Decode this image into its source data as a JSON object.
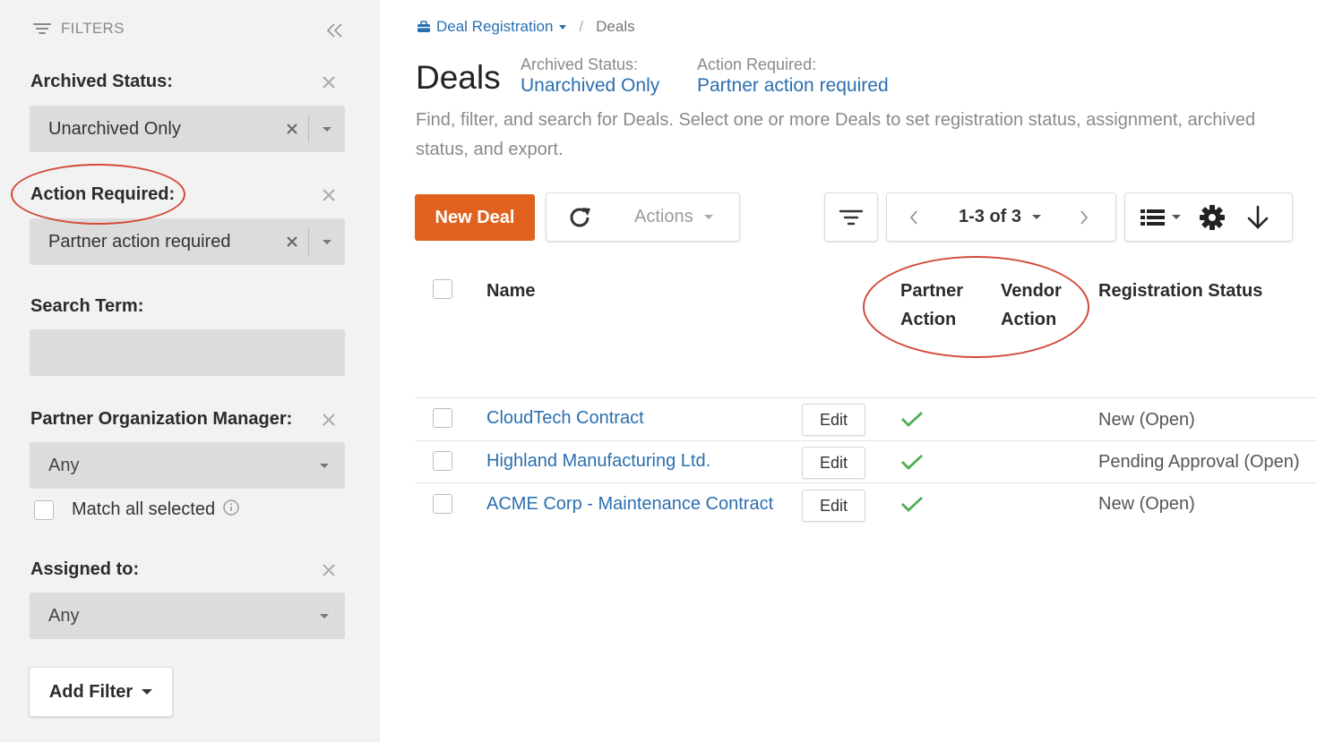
{
  "sidebar": {
    "header": "FILTERS",
    "archived": {
      "label": "Archived Status:",
      "value": "Unarchived Only"
    },
    "action": {
      "label": "Action Required:",
      "value": "Partner action required"
    },
    "search": {
      "label": "Search Term:",
      "placeholder": ""
    },
    "manager": {
      "label": "Partner Organization Manager:",
      "value": "Any",
      "match_label": "Match all selected"
    },
    "assigned": {
      "label": "Assigned to:",
      "value": "Any"
    },
    "add_filter": "Add Filter"
  },
  "breadcrumb": {
    "root": "Deal Registration",
    "current": "Deals"
  },
  "page": {
    "title": "Deals",
    "summary": [
      {
        "key": "Archived Status:",
        "value": "Unarchived Only"
      },
      {
        "key": "Action Required:",
        "value": "Partner action required"
      }
    ],
    "description": "Find, filter, and search for Deals. Select one or more Deals to set registration status, assignment, archived status, and export."
  },
  "toolbar": {
    "new_deal": "New Deal",
    "actions": "Actions",
    "pagination": "1-3 of 3"
  },
  "table": {
    "headers": {
      "name": "Name",
      "partner_action_1": "Partner",
      "partner_action_2": "Action",
      "vendor_action_1": "Vendor",
      "vendor_action_2": "Action",
      "registration_status": "Registration Status"
    },
    "edit_label": "Edit",
    "rows": [
      {
        "name": "CloudTech Contract",
        "partner_action": true,
        "status": "New (Open)"
      },
      {
        "name": "Highland Manufacturing Ltd.",
        "partner_action": true,
        "status": "Pending Approval (Open)"
      },
      {
        "name": "ACME Corp - Maintenance Contract",
        "partner_action": true,
        "status": "New (Open)"
      }
    ]
  },
  "colors": {
    "accent": "#e1621f",
    "link": "#2a6fb0",
    "check": "#4caf50",
    "annotation": "#d24a3a"
  }
}
